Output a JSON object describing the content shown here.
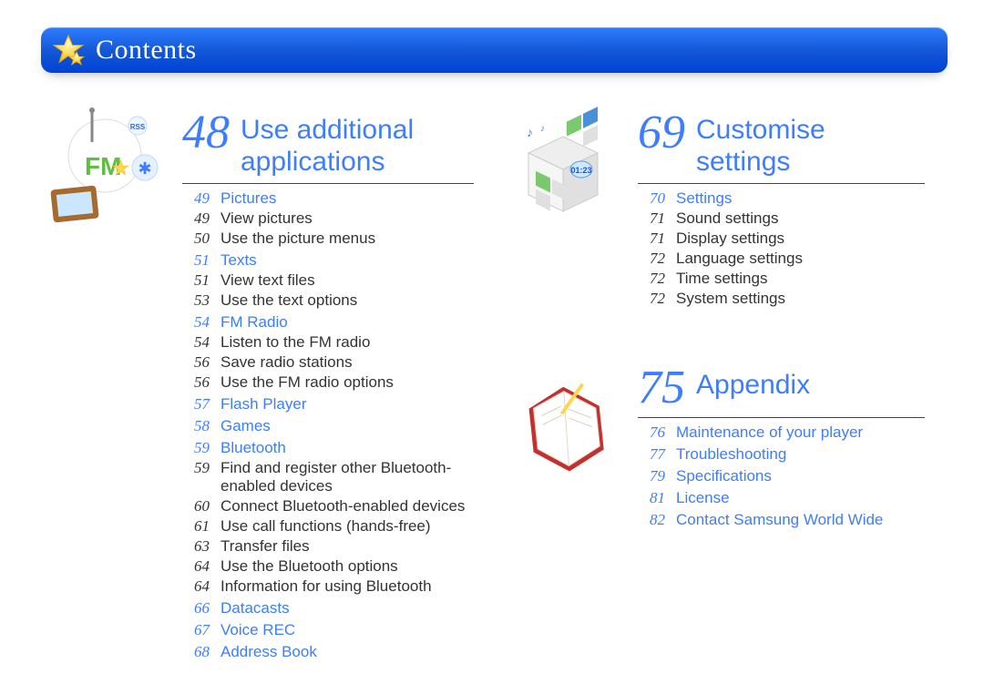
{
  "header": {
    "title": "Contents"
  },
  "left": {
    "chapter": {
      "page": "48",
      "title": "Use additional applications"
    },
    "toc": [
      {
        "type": "section",
        "page": "49",
        "label": "Pictures"
      },
      {
        "type": "item",
        "page": "49",
        "label": "View pictures"
      },
      {
        "type": "item",
        "page": "50",
        "label": "Use the picture menus"
      },
      {
        "type": "section",
        "page": "51",
        "label": "Texts"
      },
      {
        "type": "item",
        "page": "51",
        "label": "View text files"
      },
      {
        "type": "item",
        "page": "53",
        "label": "Use the text options"
      },
      {
        "type": "section",
        "page": "54",
        "label": "FM Radio"
      },
      {
        "type": "item",
        "page": "54",
        "label": "Listen to the FM radio"
      },
      {
        "type": "item",
        "page": "56",
        "label": "Save radio stations"
      },
      {
        "type": "item",
        "page": "56",
        "label": "Use the FM radio options"
      },
      {
        "type": "section",
        "page": "57",
        "label": "Flash Player"
      },
      {
        "type": "section",
        "page": "58",
        "label": "Games"
      },
      {
        "type": "section",
        "page": "59",
        "label": "Bluetooth"
      },
      {
        "type": "item",
        "page": "59",
        "label": "Find and register other Bluetooth-enabled devices"
      },
      {
        "type": "item",
        "page": "60",
        "label": "Connect Bluetooth-enabled devices"
      },
      {
        "type": "item",
        "page": "61",
        "label": "Use call functions (hands-free)"
      },
      {
        "type": "item",
        "page": "63",
        "label": "Transfer files"
      },
      {
        "type": "item",
        "page": "64",
        "label": "Use the Bluetooth options"
      },
      {
        "type": "item",
        "page": "64",
        "label": "Information for using Bluetooth"
      },
      {
        "type": "section",
        "page": "66",
        "label": "Datacasts"
      },
      {
        "type": "section",
        "page": "67",
        "label": "Voice REC"
      },
      {
        "type": "section",
        "page": "68",
        "label": "Address Book"
      }
    ]
  },
  "right1": {
    "chapter": {
      "page": "69",
      "title": "Customise settings"
    },
    "toc": [
      {
        "type": "section",
        "page": "70",
        "label": "Settings"
      },
      {
        "type": "item",
        "page": "71",
        "label": "Sound settings"
      },
      {
        "type": "item",
        "page": "71",
        "label": "Display settings"
      },
      {
        "type": "item",
        "page": "72",
        "label": "Language settings"
      },
      {
        "type": "item",
        "page": "72",
        "label": "Time settings"
      },
      {
        "type": "item",
        "page": "72",
        "label": "System settings"
      }
    ]
  },
  "right2": {
    "chapter": {
      "page": "75",
      "title": "Appendix"
    },
    "toc": [
      {
        "type": "section",
        "page": "76",
        "label": "Maintenance of your player"
      },
      {
        "type": "section",
        "page": "77",
        "label": "Troubleshooting"
      },
      {
        "type": "section",
        "page": "79",
        "label": "Specifications"
      },
      {
        "type": "section",
        "page": "81",
        "label": "License"
      },
      {
        "type": "section",
        "page": "82",
        "label": "Contact Samsung World Wide"
      }
    ]
  }
}
